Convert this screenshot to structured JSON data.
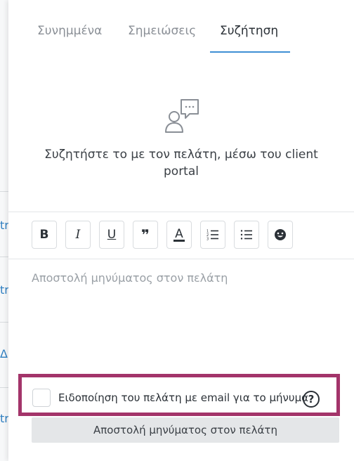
{
  "background": {
    "row_fragments": [
      "tr",
      "tr",
      "Δ",
      "tr"
    ]
  },
  "tabs": [
    {
      "label": "Συνημμένα",
      "active": false
    },
    {
      "label": "Σημειώσεις",
      "active": false
    },
    {
      "label": "Συζήτηση",
      "active": true
    }
  ],
  "empty_state": {
    "icon": "chat-person-icon",
    "text": "Συζητήστε το με τον πελάτη, μέσω του client portal"
  },
  "toolbar": {
    "buttons": [
      {
        "name": "bold",
        "glyph": "B"
      },
      {
        "name": "italic",
        "glyph": "I"
      },
      {
        "name": "underline",
        "glyph": "U"
      },
      {
        "name": "quote",
        "glyph": "❞"
      },
      {
        "name": "text-color",
        "glyph": "A"
      },
      {
        "name": "ordered-list",
        "glyph": "≡"
      },
      {
        "name": "bullet-list",
        "glyph": "☰"
      },
      {
        "name": "emoji",
        "glyph": "☺"
      }
    ]
  },
  "message": {
    "value": "",
    "placeholder": "Αποστολή μηνύματος στον πελάτη"
  },
  "notify": {
    "label": "Ειδοποίηση του πελάτη με email για το μήνυμα",
    "checked": false,
    "help_glyph": "?"
  },
  "send_button": {
    "label": "Αποστολή μηνύματος στον πελάτη"
  },
  "colors": {
    "accent": "#3f8fd4",
    "highlight": "#a3346a",
    "button_bg": "#e4e6e8"
  }
}
